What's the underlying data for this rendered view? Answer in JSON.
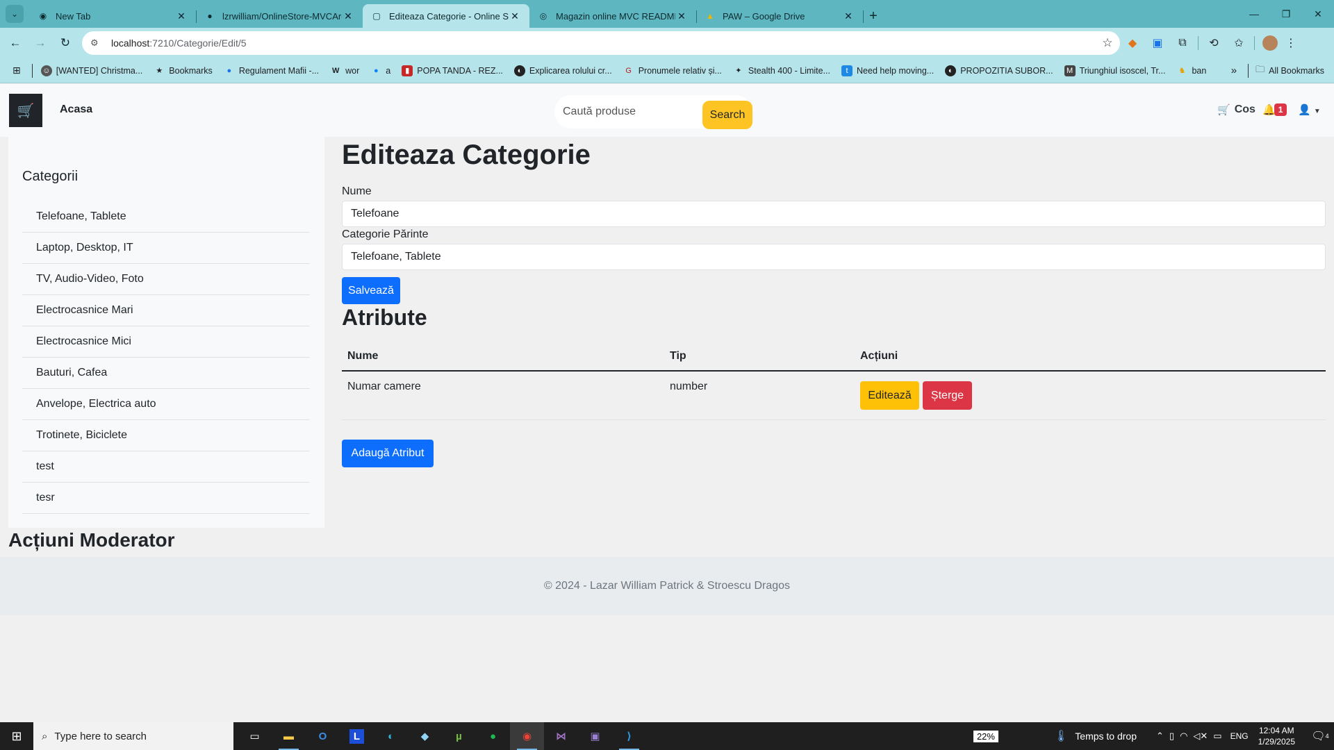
{
  "browser": {
    "tabs": [
      {
        "title": "New Tab",
        "icon": "chrome-icon"
      },
      {
        "title": "lzrwilliam/OnlineStore-MVCArch",
        "icon": "github-icon"
      },
      {
        "title": "Editeaza Categorie - Online Store",
        "icon": "page-icon"
      },
      {
        "title": "Magazin online MVC README",
        "icon": "globe-icon"
      },
      {
        "title": "PAW – Google Drive",
        "icon": "drive-icon"
      }
    ],
    "url_host": "localhost",
    "url_path": ":7210/Categorie/Edit/5",
    "bookmarks": [
      "[WANTED] Christma...",
      "Bookmarks",
      "Regulament Mafii -...",
      "wor",
      "a",
      "POPA TANDA - REZ...",
      "Explicarea rolului cr...",
      "Pronumele relativ și...",
      "Stealth 400 - Limite...",
      "Need help moving...",
      "PROPOZITIA SUBOR...",
      "Triunghiul isoscel, Tr...",
      "ban"
    ],
    "all_bookmarks": "All Bookmarks"
  },
  "site": {
    "home": "Acasa",
    "search_placeholder": "Caută produse",
    "search_button": "Search",
    "cart": "Cos",
    "notification_count": "1"
  },
  "sidebar": {
    "title": "Categorii",
    "items": [
      "Telefoane, Tablete",
      "Laptop, Desktop, IT",
      "TV, Audio-Video, Foto",
      "Electrocasnice Mari",
      "Electrocasnice Mici",
      "Bauturi, Cafea",
      "Anvelope, Electrica auto",
      "Trotinete, Biciclete",
      "test",
      "tesr"
    ]
  },
  "form": {
    "title": "Editeaza Categorie",
    "name_label": "Nume",
    "name_value": "Telefoane",
    "parent_label": "Categorie Părinte",
    "parent_value": "Telefoane, Tablete",
    "save": "Salvează"
  },
  "attributes": {
    "title": "Atribute",
    "columns": [
      "Nume",
      "Tip",
      "Acțiuni"
    ],
    "rows": [
      {
        "name": "Numar camere",
        "type": "number",
        "edit": "Editează",
        "delete": "Șterge"
      }
    ],
    "add": "Adaugă Atribut"
  },
  "moderator_title": "Acțiuni Moderator",
  "footer": "© 2024 - Lazar William Patrick & Stroescu Dragos",
  "taskbar": {
    "search": "Type here to search",
    "battery": "22%",
    "weather": "Temps to drop",
    "lang": "ENG",
    "time": "12:04 AM",
    "date": "1/29/2025",
    "notifications": "4"
  },
  "colors": {
    "chrome": "#5db6c0",
    "primary": "#0d6efd",
    "warning": "#ffc107",
    "danger": "#dc3545",
    "search_button": "#fec424"
  }
}
